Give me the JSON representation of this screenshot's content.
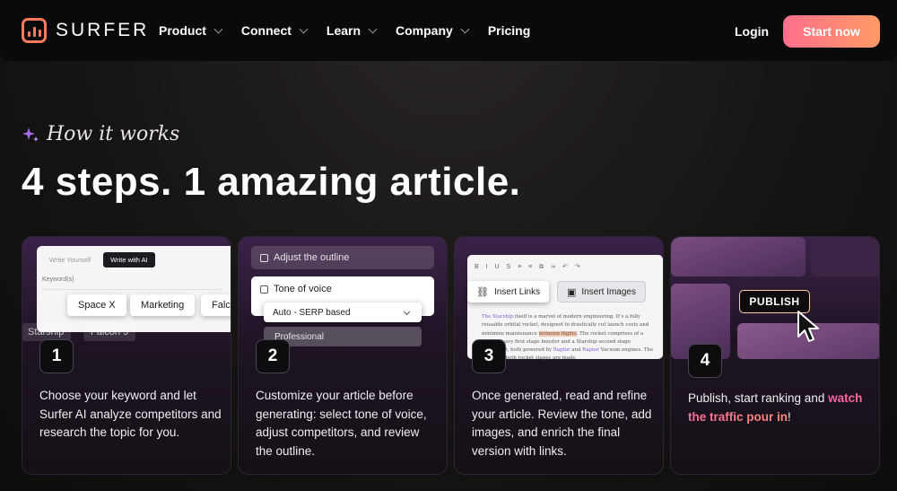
{
  "nav": {
    "brand": "SURFER",
    "items": [
      {
        "label": "Product",
        "has_dropdown": true
      },
      {
        "label": "Connect",
        "has_dropdown": true
      },
      {
        "label": "Learn",
        "has_dropdown": true
      },
      {
        "label": "Company",
        "has_dropdown": true
      },
      {
        "label": "Pricing",
        "has_dropdown": false
      }
    ],
    "login": "Login",
    "cta": "Start now"
  },
  "hero": {
    "eyebrow": "How it works",
    "headline": "4 steps. 1 amazing article."
  },
  "steps": [
    {
      "number": "1",
      "text": "Choose your keyword and let Surfer AI analyze competitors and research the topic for you.",
      "illustration": {
        "tab_inactive": "Write Yourself",
        "tab_active": "Write with AI",
        "field_label": "Keyword(s)",
        "chips": [
          "Space X",
          "Marketing",
          "Falco"
        ],
        "dim_chips": [
          "Starship",
          "Falcon 9"
        ]
      }
    },
    {
      "number": "2",
      "text": "Customize your article before generating: select tone of voice, adjust competitors, and review the outline.",
      "illustration": {
        "outline": "Adjust the outline",
        "tone": "Tone of voice",
        "selected": "Auto - SERP based",
        "option": "Professional"
      }
    },
    {
      "number": "3",
      "text": "Once generated, read and refine your article. Review the tone, add images, and enrich the final version with links.",
      "illustration": {
        "insert_links": "Insert Links",
        "insert_images": "Insert Images",
        "toolbar": "B I U S ≡ ≡ ⧉ ∞ ↶ ↷"
      }
    },
    {
      "number": "4",
      "text_before": "Publish, start ranking and ",
      "text_highlight": "watch the traffic pour in",
      "text_after": "!",
      "illustration": {
        "publish_button": "PUBLISH"
      }
    }
  ],
  "colors": {
    "cta_gradient_start": "#ff6f8c",
    "cta_gradient_end": "#ff9a66",
    "card_accent": "#3a2248",
    "highlight": "#ff5fa8"
  }
}
